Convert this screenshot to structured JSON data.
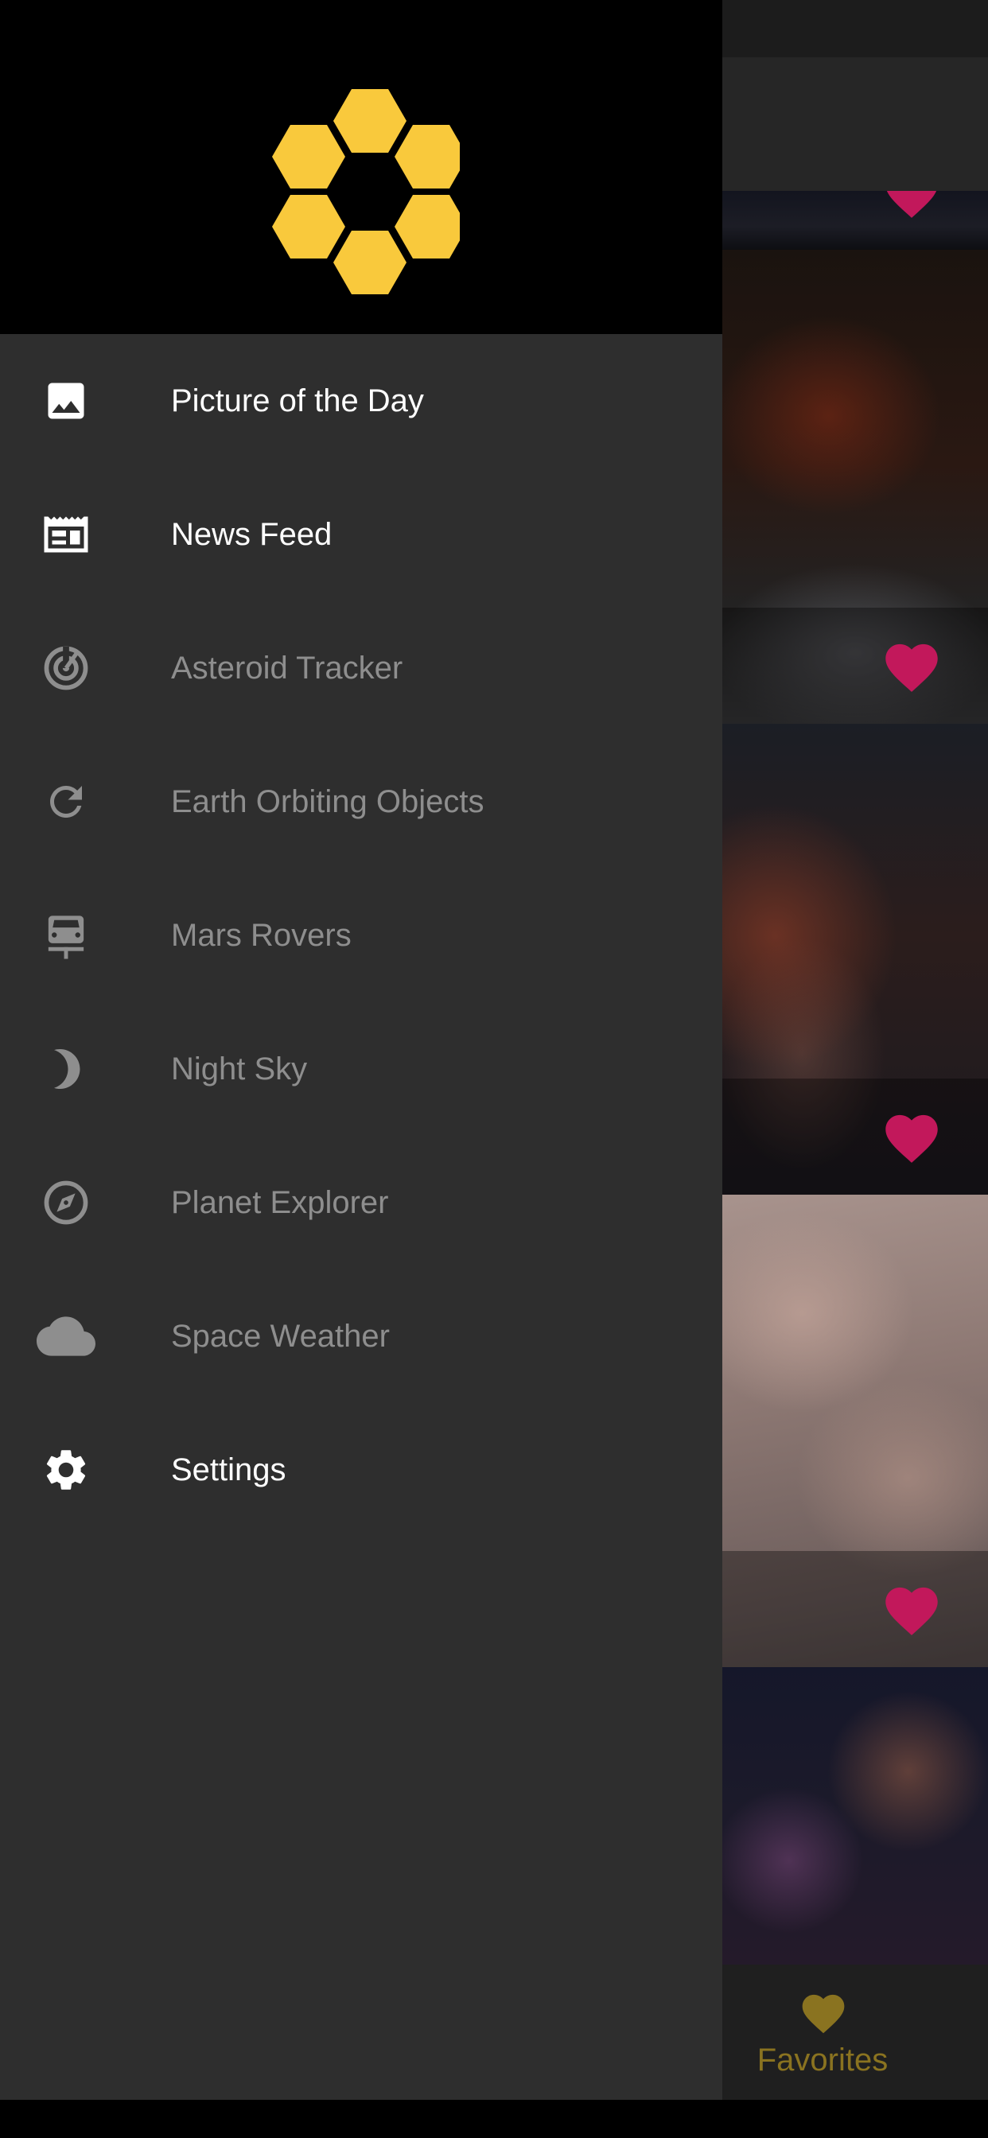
{
  "colors": {
    "drawer_background": "#2e2e2e",
    "header_background": "#000000",
    "logo_yellow": "#f9c93c",
    "enabled_text": "#ffffff",
    "disabled_text": "#8e8e8e",
    "favorite_heart": "#c2185b",
    "bottom_nav_accent": "#8a7320"
  },
  "drawer": {
    "logo_icon": "hexagon-ring-logo",
    "items": [
      {
        "label": "Picture of the Day",
        "icon": "image-icon",
        "enabled": true
      },
      {
        "label": "News Feed",
        "icon": "newspaper-icon",
        "enabled": true
      },
      {
        "label": "Asteroid Tracker",
        "icon": "radar-icon",
        "enabled": false
      },
      {
        "label": "Earth Orbiting Objects",
        "icon": "refresh-icon",
        "enabled": false
      },
      {
        "label": "Mars Rovers",
        "icon": "rover-icon",
        "enabled": false
      },
      {
        "label": "Night Sky",
        "icon": "moon-icon",
        "enabled": false
      },
      {
        "label": "Planet Explorer",
        "icon": "compass-icon",
        "enabled": false
      },
      {
        "label": "Space Weather",
        "icon": "cloud-icon",
        "enabled": false
      },
      {
        "label": "Settings",
        "icon": "gear-icon",
        "enabled": true
      }
    ]
  },
  "background": {
    "feed_cards": [
      {
        "favorite": true
      },
      {
        "favorite": true
      },
      {
        "favorite": true
      },
      {
        "favorite": true
      },
      {
        "favorite": false
      }
    ],
    "bottom_nav": {
      "favorites_label": "Favorites",
      "favorites_icon": "heart-icon"
    }
  }
}
